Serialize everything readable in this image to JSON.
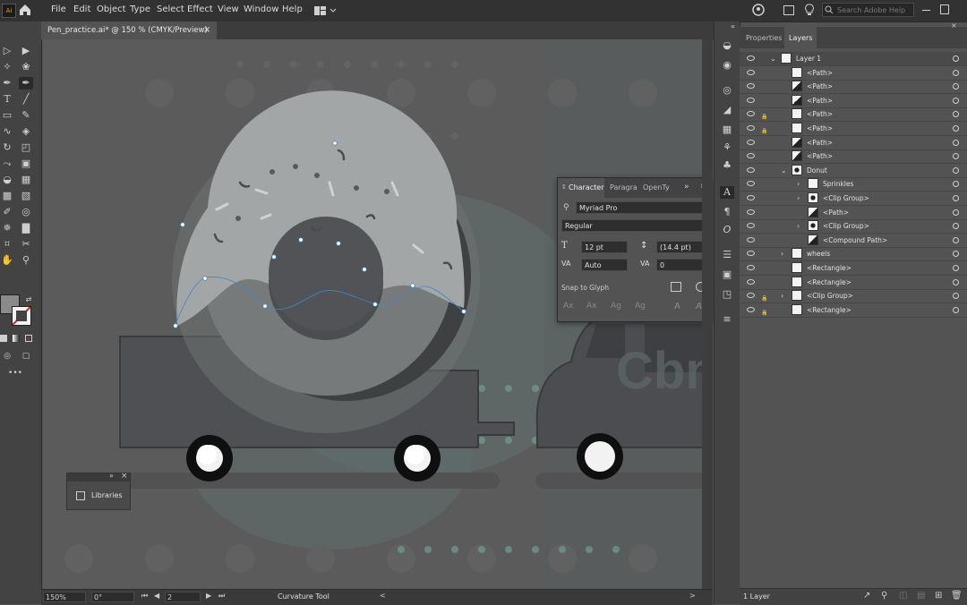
{
  "app": {
    "logo": "Ai"
  },
  "menu": [
    "File",
    "Edit",
    "Object",
    "Type",
    "Select",
    "Effect",
    "View",
    "Window",
    "Help"
  ],
  "header": {
    "search_placeholder": "Search Adobe Help"
  },
  "document": {
    "tab_title": "Pen_practice.ai* @ 150 % (CMYK/Preview)"
  },
  "status": {
    "zoom": "150%",
    "rotation": "0°",
    "artboard": "2",
    "tool": "Curvature Tool"
  },
  "character_panel": {
    "tabs": [
      "Character",
      "Paragraph",
      "OpenType"
    ],
    "font_family": "Myriad Pro",
    "font_style": "Regular",
    "font_size": "12 pt",
    "leading": "(14.4 pt)",
    "kerning": "Auto",
    "tracking": "0",
    "snap_label": "Snap to Glyph"
  },
  "libraries": {
    "title": "Libraries"
  },
  "layers_panel": {
    "tabs": [
      "Properties",
      "Layers"
    ],
    "rows": [
      {
        "name": "Layer 1",
        "level": 0,
        "expanded": true,
        "locked": false
      },
      {
        "name": "<Path>",
        "level": 1,
        "locked": false
      },
      {
        "name": "<Path>",
        "level": 1,
        "locked": false
      },
      {
        "name": "<Path>",
        "level": 1,
        "locked": false
      },
      {
        "name": "<Path>",
        "level": 1,
        "locked": true
      },
      {
        "name": "<Path>",
        "level": 1,
        "locked": true
      },
      {
        "name": "<Path>",
        "level": 1,
        "locked": false
      },
      {
        "name": "<Path>",
        "level": 1,
        "locked": false
      },
      {
        "name": "Donut",
        "level": 1,
        "expanded": true,
        "locked": false
      },
      {
        "name": "Sprinkles",
        "level": 2,
        "collapsed": true,
        "locked": false
      },
      {
        "name": "<Clip Group>",
        "level": 2,
        "collapsed": true,
        "locked": false
      },
      {
        "name": "<Path>",
        "level": 2,
        "locked": false
      },
      {
        "name": "<Clip Group>",
        "level": 2,
        "collapsed": true,
        "locked": false
      },
      {
        "name": "<Compound Path>",
        "level": 2,
        "locked": false
      },
      {
        "name": "wheels",
        "level": 1,
        "collapsed": true,
        "locked": false
      },
      {
        "name": "<Rectangle>",
        "level": 1,
        "locked": false
      },
      {
        "name": "<Rectangle>",
        "level": 1,
        "locked": false
      },
      {
        "name": "<Clip Group>",
        "level": 1,
        "collapsed": true,
        "locked": true
      },
      {
        "name": "<Rectangle>",
        "level": 1,
        "locked": true
      }
    ],
    "footer": "1 Layer"
  },
  "colors": {
    "ui_dark": "#323232",
    "panel": "#535353",
    "canvas": "#5b5b5b",
    "teal": "#6fa89a",
    "selection": "#ffffff"
  },
  "canvas_watermark": "Cbm"
}
